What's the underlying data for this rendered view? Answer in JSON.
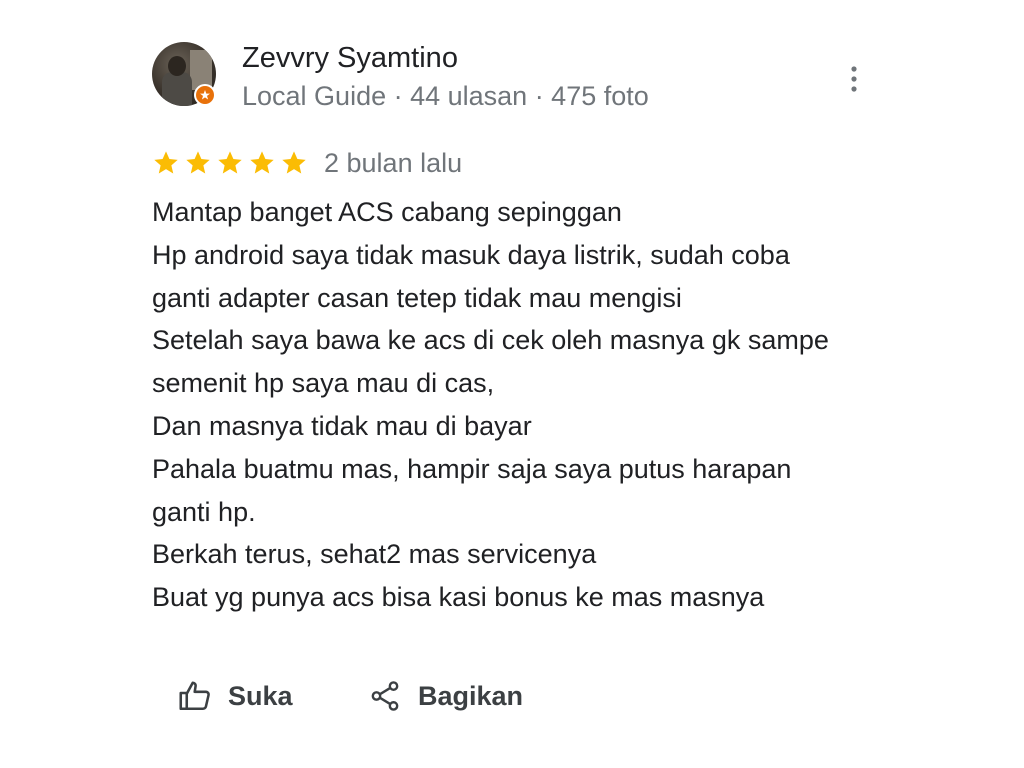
{
  "reviewer": {
    "name": "Zevvry Syamtino",
    "meta": "Local Guide · 44 ulasan · 475 foto",
    "avatar_icon": "profile-photo",
    "badge_icon": "local-guide-star-icon",
    "badge_color": "#e8710a"
  },
  "rating": {
    "stars": 5,
    "max": 5,
    "star_color": "#fbbc04",
    "time": "2 bulan lalu"
  },
  "review": {
    "lines": [
      "Mantap banget ACS cabang sepinggan",
      "Hp android saya tidak masuk daya listrik, sudah coba",
      "ganti adapter casan tetep tidak mau mengisi",
      "Setelah saya bawa ke acs di cek oleh masnya gk sampe",
      "semenit hp saya mau di cas,",
      "Dan masnya tidak mau di bayar",
      "Pahala buatmu mas, hampir saja saya putus harapan",
      "ganti hp.",
      "Berkah terus, sehat2 mas servicenya",
      "Buat yg punya acs bisa kasi bonus ke mas masnya"
    ]
  },
  "actions": {
    "like_label": "Suka",
    "like_icon": "thumb-up-icon",
    "share_label": "Bagikan",
    "share_icon": "share-icon",
    "more_icon": "more-vert-icon"
  }
}
